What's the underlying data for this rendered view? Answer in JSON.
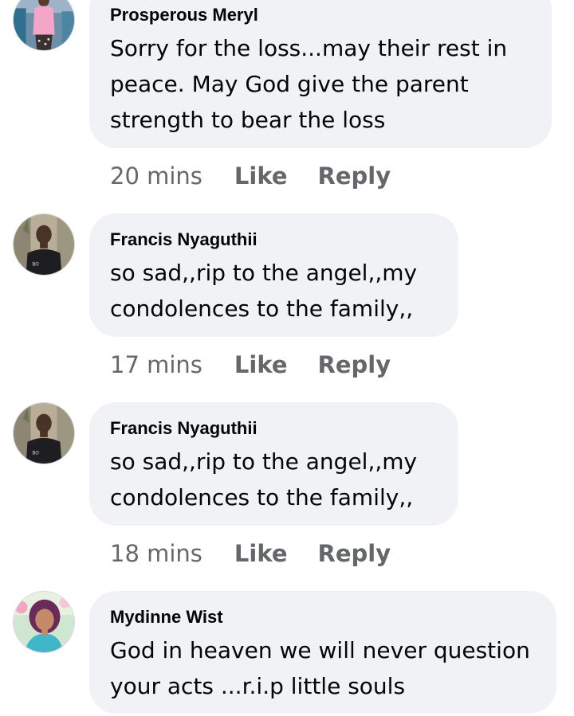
{
  "comments": [
    {
      "author": "Prosperous Meryl",
      "text": "Sorry for the loss...may their rest in peace. May God give the parent strength to bear the loss",
      "time": "20 mins",
      "like_label": "Like",
      "reply_label": "Reply",
      "avatar_icon": "person-photo-pink-dress-icon"
    },
    {
      "author": "Francis Nyaguthii",
      "text": "so sad,,rip to the angel,,my condolences  to the family,,",
      "time": "17 mins",
      "like_label": "Like",
      "reply_label": "Reply",
      "avatar_icon": "person-photo-black-shirt-icon"
    },
    {
      "author": "Francis Nyaguthii",
      "text": "so sad,,rip to the angel,,my condolences  to the family,,",
      "time": "18 mins",
      "like_label": "Like",
      "reply_label": "Reply",
      "avatar_icon": "person-photo-black-shirt-icon"
    },
    {
      "author": "Mydinne Wist",
      "text": "God in heaven we will never question your acts ...r.i.p little souls",
      "avatar_icon": "person-photo-purple-hair-icon"
    }
  ],
  "colors": {
    "bubble": "#f0f2f5",
    "author_text": "#050505",
    "meta_text": "#65676b"
  }
}
